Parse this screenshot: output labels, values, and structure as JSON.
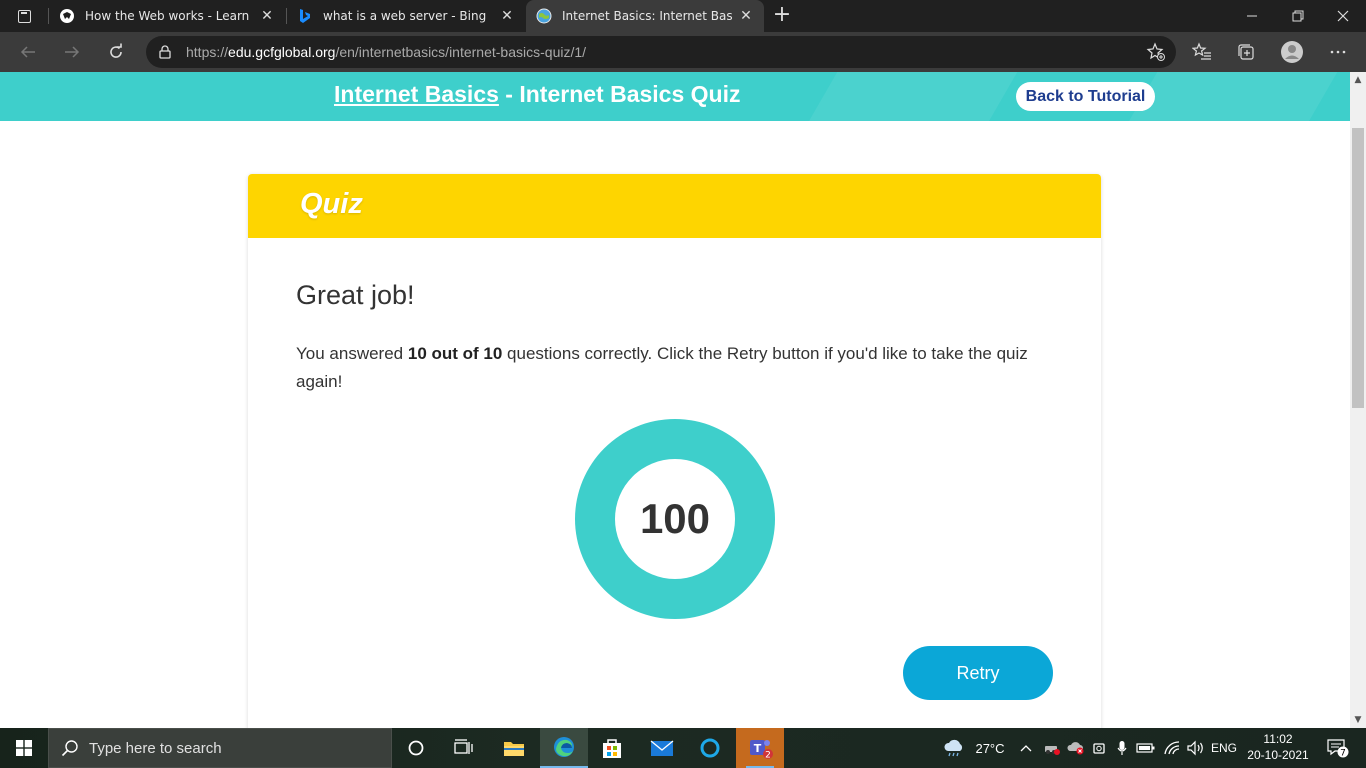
{
  "browser": {
    "tabs": [
      {
        "title": "How the Web works - Learn web",
        "active": false
      },
      {
        "title": "what is a web server - Bing",
        "active": false
      },
      {
        "title": "Internet Basics: Internet Basics Q",
        "active": true
      }
    ],
    "url": {
      "scheme": "https://",
      "host": "edu.gcfglobal.org",
      "path": "/en/internetbasics/internet-basics-quiz/1/"
    }
  },
  "page": {
    "course_link": "Internet Basics",
    "separator": " - ",
    "page_title": "Internet Basics Quiz",
    "back_button": "Back to Tutorial",
    "quiz_header": "Quiz",
    "heading": "Great job!",
    "result_prefix": "You answered ",
    "result_score": "10 out of 10",
    "result_suffix": " questions correctly. Click the Retry button if you'd like to take the quiz again!",
    "score": "100",
    "retry_button": "Retry"
  },
  "taskbar": {
    "search_placeholder": "Type here to search",
    "weather": "27°C",
    "language": "ENG",
    "time": "11:02",
    "date": "20-10-2021",
    "teams_badge": "2",
    "notification_count": "7"
  },
  "colors": {
    "teal": "#3ecfcb",
    "quiz_yellow": "#fed500",
    "retry_blue": "#0ba7d7",
    "back_text": "#1e3d8f"
  }
}
